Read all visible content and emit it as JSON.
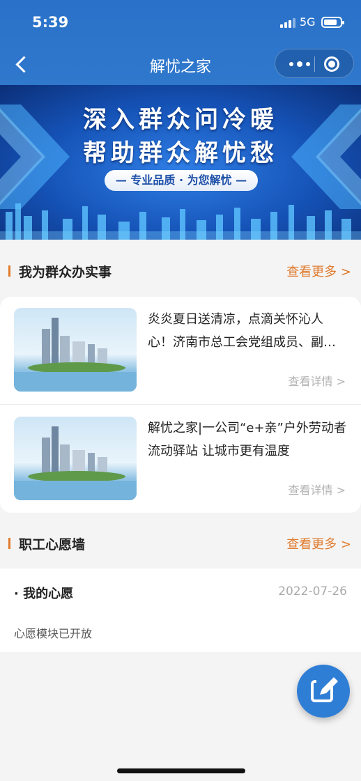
{
  "status_bar": {
    "time": "5:39",
    "network": "5G"
  },
  "nav": {
    "title": "解忧之家"
  },
  "banner": {
    "line1": "深入群众问冷暖",
    "line2": "帮助群众解忧愁",
    "slogan": "— 专业品质 · 为您解忧 —"
  },
  "section_service": {
    "title": "我为群众办实事",
    "more": "查看更多 >"
  },
  "news": [
    {
      "title": "炎炎夏日送清凉，点滴关怀沁人心！济南市总工会党组成员、副主席……",
      "detail": "查看详情 >"
    },
    {
      "title": "解忧之家|一公司“e+亲”户外劳动者流动驿站 让城市更有温度",
      "detail": "查看详情 >"
    }
  ],
  "section_wish": {
    "title": "职工心愿墙",
    "more": "查看更多 >"
  },
  "wish": {
    "label": "· 我的心愿",
    "date": "2022-07-26",
    "desc": "心愿模块已开放"
  },
  "colors": {
    "primary": "#2f78cc",
    "accent": "#e07a2c"
  },
  "icons": {
    "back": "chevron-left-icon",
    "menu": "more-dots-icon",
    "target": "target-icon",
    "fab": "edit-icon"
  }
}
